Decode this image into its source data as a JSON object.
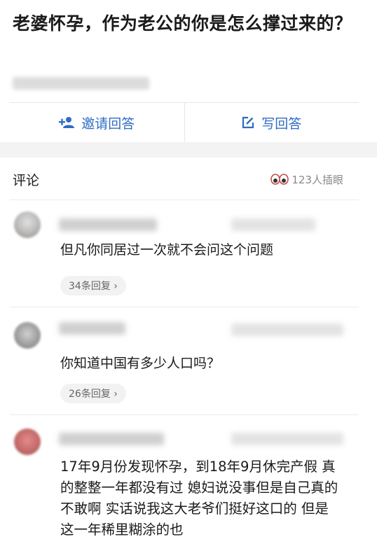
{
  "question": {
    "title": "老婆怀孕，作为老公的你是怎么撑过来的？"
  },
  "actions": {
    "invite_label": "邀请回答",
    "write_label": "写回答",
    "accent_color": "#2f6cc4"
  },
  "comments": {
    "title": "评论",
    "peek_text": "123人插眼",
    "items": [
      {
        "text": "但凡你同居过一次就不会问这个问题",
        "replies": "34条回复 ›"
      },
      {
        "text": "你知道中国有多少人口吗？",
        "replies": "26条回复 ›"
      },
      {
        "text": "17年9月份发现怀孕，到18年9月休完产假 真的整整一年都没有过 媳妇说没事但是自己真的不敢啊 实话说我这大老爷们挺好这口的 但是这一年稀里糊涂的也"
      }
    ]
  }
}
